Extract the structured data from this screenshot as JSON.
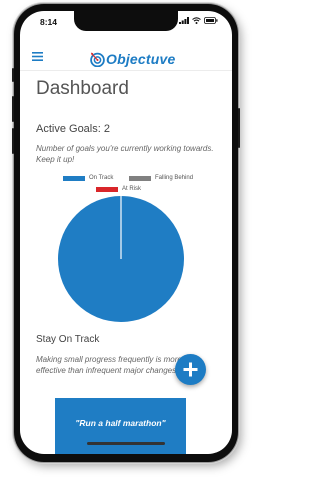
{
  "status_bar": {
    "time": "8:14"
  },
  "header": {
    "logo_text": "Objectuve",
    "menu_icon": "hamburger-icon"
  },
  "page": {
    "title": "Dashboard"
  },
  "goals": {
    "heading": "Active Goals: 2",
    "description": "Number of goals you're currently working towards. Keep it up!"
  },
  "legend": [
    {
      "label": "On Track",
      "color": "#1f7dc4"
    },
    {
      "label": "Falling Behind",
      "color": "#808080"
    },
    {
      "label": "At Risk",
      "color": "#d9262a"
    }
  ],
  "chart_data": {
    "type": "pie",
    "labels": [
      "On Track",
      "Falling Behind",
      "At Risk"
    ],
    "values": [
      2,
      0,
      0
    ],
    "colors": [
      "#1f7dc4",
      "#808080",
      "#d9262a"
    ]
  },
  "stay_on_track": {
    "heading": "Stay On Track",
    "description": "Making small progress frequently is more effective than infrequent major changes."
  },
  "fab": {
    "icon": "plus-icon"
  },
  "goal_card": {
    "title": "\"Run a half marathon\""
  }
}
